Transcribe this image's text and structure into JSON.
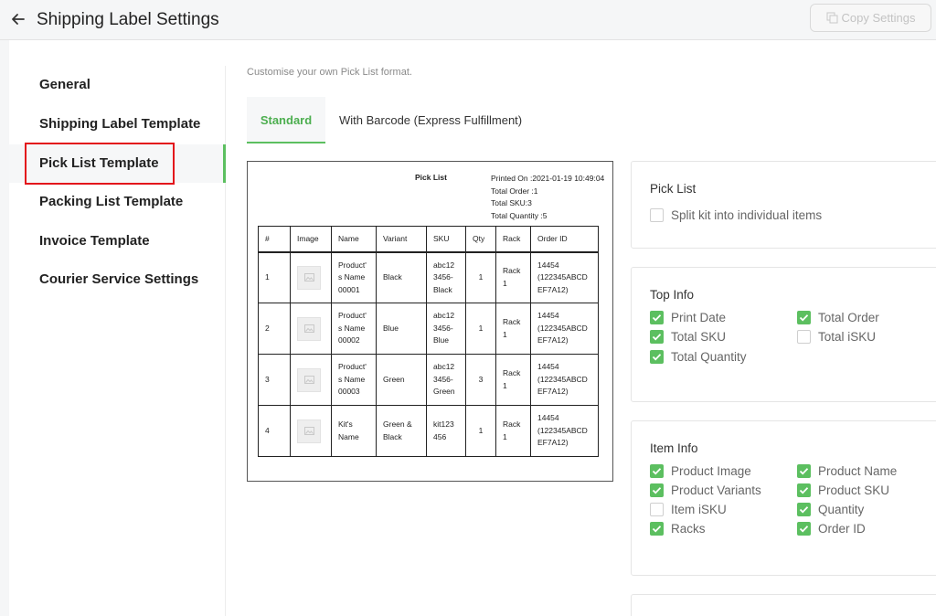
{
  "header": {
    "title": "Shipping Label Settings",
    "copy_label": "Copy Settings"
  },
  "sidebar": {
    "items": [
      {
        "label": "General",
        "active": false
      },
      {
        "label": "Shipping Label Template",
        "active": false
      },
      {
        "label": "Pick List Template",
        "active": true
      },
      {
        "label": "Packing List Template",
        "active": false
      },
      {
        "label": "Invoice Template",
        "active": false
      },
      {
        "label": "Courier Service Settings",
        "active": false
      }
    ]
  },
  "content": {
    "hint": "Customise your own Pick List format.",
    "tabs": [
      {
        "label": "Standard",
        "active": true
      },
      {
        "label": "With Barcode (Express Fulfillment)",
        "active": false
      }
    ]
  },
  "preview": {
    "title": "Pick List",
    "meta": {
      "printed_on": "Printed On :2021-01-19 10:49:04",
      "total_order": "Total Order :1",
      "total_sku": "Total SKU:3",
      "total_quantity": "Total Quantity :5"
    },
    "columns": [
      "#",
      "Image",
      "Name",
      "Variant",
      "SKU",
      "Qty",
      "Rack",
      "Order ID"
    ],
    "rows": [
      {
        "num": "1",
        "name_lines": [
          "Product'",
          "s Name",
          "00001"
        ],
        "variant_lines": [
          "Black"
        ],
        "sku_lines": [
          "abc12",
          "3456-",
          "Black"
        ],
        "qty": "1",
        "rack_lines": [
          "Rack",
          "1"
        ],
        "order_lines": [
          "14454",
          "(122345ABCD",
          "EF7A12)"
        ]
      },
      {
        "num": "2",
        "name_lines": [
          "Product'",
          "s Name",
          "00002"
        ],
        "variant_lines": [
          "Blue"
        ],
        "sku_lines": [
          "abc12",
          "3456-",
          "Blue"
        ],
        "qty": "1",
        "rack_lines": [
          "Rack",
          "1"
        ],
        "order_lines": [
          "14454",
          "(122345ABCD",
          "EF7A12)"
        ]
      },
      {
        "num": "3",
        "name_lines": [
          "Product'",
          "s Name",
          "00003"
        ],
        "variant_lines": [
          "Green"
        ],
        "sku_lines": [
          "abc12",
          "3456-",
          "Green"
        ],
        "qty": "3",
        "rack_lines": [
          "Rack",
          "1"
        ],
        "order_lines": [
          "14454",
          "(122345ABCD",
          "EF7A12)"
        ]
      },
      {
        "num": "4",
        "name_lines": [
          "Kit's",
          "Name"
        ],
        "variant_lines": [
          "Green &",
          "Black"
        ],
        "sku_lines": [
          "kit123",
          "456"
        ],
        "qty": "1",
        "rack_lines": [
          "Rack",
          "1"
        ],
        "order_lines": [
          "14454",
          "(122345ABCD",
          "EF7A12)"
        ]
      }
    ]
  },
  "pick_list_card": {
    "title": "Pick List",
    "options": [
      {
        "label": "Split kit into individual items",
        "checked": false
      }
    ]
  },
  "top_info_card": {
    "title": "Top Info",
    "options": [
      {
        "label": "Print Date",
        "checked": true
      },
      {
        "label": "Total Order",
        "checked": true
      },
      {
        "label": "Total SKU",
        "checked": true
      },
      {
        "label": "Total iSKU",
        "checked": false
      },
      {
        "label": "Total Quantity",
        "checked": true
      }
    ]
  },
  "item_info_card": {
    "title": "Item Info",
    "options": [
      {
        "label": "Product Image",
        "checked": true
      },
      {
        "label": "Product Name",
        "checked": true
      },
      {
        "label": "Product Variants",
        "checked": true
      },
      {
        "label": "Product SKU",
        "checked": true
      },
      {
        "label": "Item iSKU",
        "checked": false
      },
      {
        "label": "Quantity",
        "checked": true
      },
      {
        "label": "Racks",
        "checked": true
      },
      {
        "label": "Order ID",
        "checked": true
      }
    ]
  },
  "colors": {
    "accent": "#5cbf60",
    "highlight": "#e3141b"
  }
}
